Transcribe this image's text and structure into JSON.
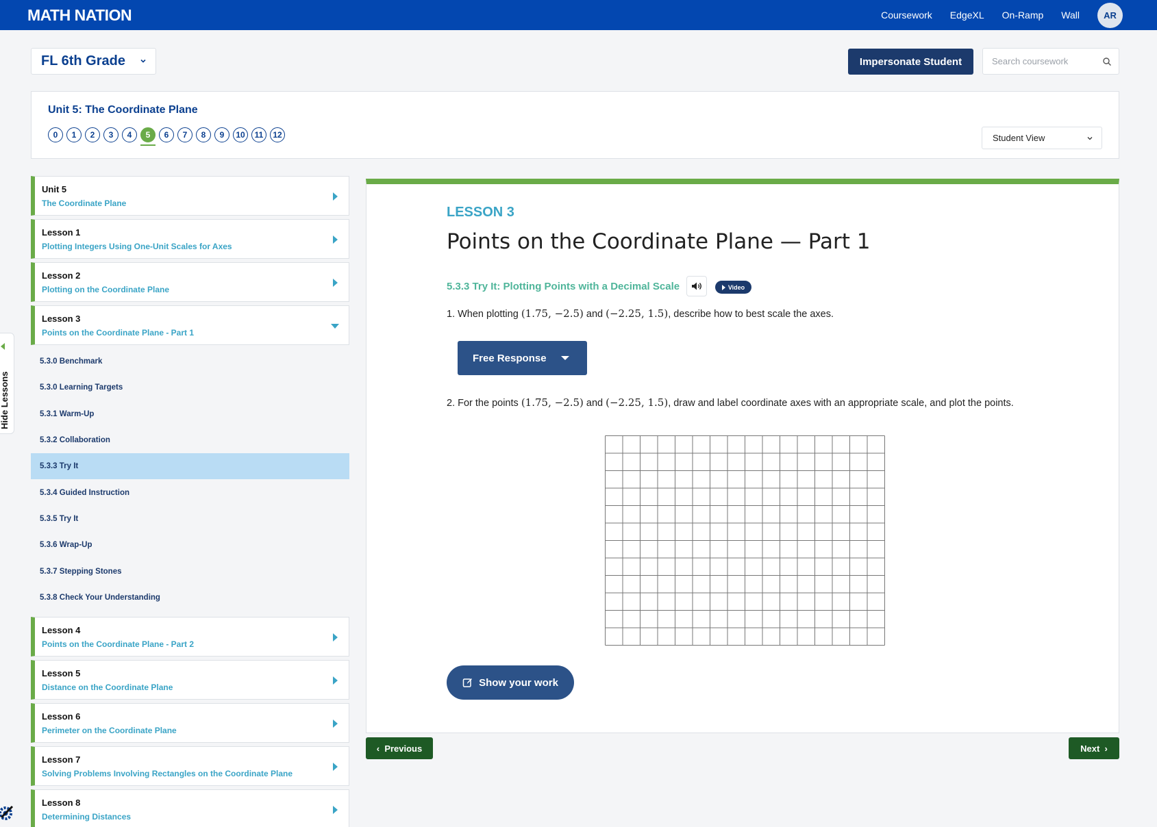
{
  "brand": {
    "logo": "MATH NATION"
  },
  "topnav": {
    "items": [
      "Coursework",
      "EdgeXL",
      "On-Ramp",
      "Wall"
    ],
    "avatar": "AR"
  },
  "course": {
    "selected": "FL 6th Grade"
  },
  "header": {
    "impersonate_label": "Impersonate Student",
    "search_placeholder": "Search coursework"
  },
  "unit": {
    "title": "Unit 5: The Coordinate Plane",
    "numbers": [
      "0",
      "1",
      "2",
      "3",
      "4",
      "5",
      "6",
      "7",
      "8",
      "9",
      "10",
      "11",
      "12"
    ],
    "active_number": "5",
    "view_select": "Student View"
  },
  "sidebar": {
    "hide_label": "Hide Lessons",
    "lessons": [
      {
        "label": "Unit 5",
        "title": "The Coordinate Plane",
        "expanded": false
      },
      {
        "label": "Lesson 1",
        "title": "Plotting Integers Using One-Unit Scales for Axes",
        "expanded": false
      },
      {
        "label": "Lesson 2",
        "title": "Plotting on the Coordinate Plane",
        "expanded": false
      },
      {
        "label": "Lesson 3",
        "title": "Points on the Coordinate Plane - Part 1",
        "expanded": true
      },
      {
        "label": "Lesson 4",
        "title": "Points on the Coordinate Plane - Part 2",
        "expanded": false
      },
      {
        "label": "Lesson 5",
        "title": "Distance on the Coordinate Plane",
        "expanded": false
      },
      {
        "label": "Lesson 6",
        "title": "Perimeter on the Coordinate Plane",
        "expanded": false
      },
      {
        "label": "Lesson 7",
        "title": "Solving Problems Involving Rectangles on the Coordinate Plane",
        "expanded": false
      },
      {
        "label": "Lesson 8",
        "title": "Determining Distances",
        "expanded": false
      }
    ],
    "subitems": [
      "5.3.0 Benchmark",
      "5.3.0 Learning Targets",
      "5.3.1 Warm-Up",
      "5.3.2 Collaboration",
      "5.3.3 Try It",
      "5.3.4 Guided Instruction",
      "5.3.5 Try It",
      "5.3.6 Wrap-Up",
      "5.3.7 Stepping Stones",
      "5.3.8 Check Your Understanding"
    ],
    "selected_subitem": "5.3.3 Try It"
  },
  "content": {
    "lesson_label": "LESSON 3",
    "lesson_title": "Points on the Coordinate Plane — Part 1",
    "section_title": "5.3.3 Try It: Plotting Points with a Decimal Scale",
    "video_label": "Video",
    "q1": {
      "pre": "1. When plotting ",
      "p1": "(1.75, −2.5)",
      "mid": " and ",
      "p2": "(−2.25, 1.5)",
      "post": ", describe how to best scale the axes."
    },
    "free_response_label": "Free Response",
    "q2": {
      "pre": "2. For the points ",
      "p1": "(1.75, −2.5)",
      "mid": " and ",
      "p2": "(−2.25, 1.5)",
      "post": ", draw and label coordinate axes with an appropriate scale, and plot the points."
    },
    "grid": {
      "columns": 16,
      "rows": 12
    },
    "show_work_label": "Show your work"
  },
  "pager": {
    "previous": "Previous",
    "next": "Next"
  },
  "colors": {
    "topbar": "#0347b0",
    "navy": "#1c3a6c",
    "green": "#6aab48",
    "teal": "#3aa4c6",
    "dark_green": "#1e5a25",
    "selected_bg": "#b9dcf4"
  }
}
